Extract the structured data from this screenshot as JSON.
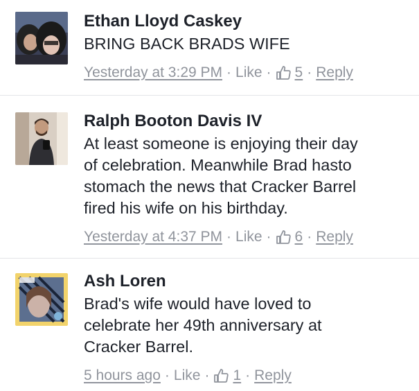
{
  "comments": [
    {
      "author": "Ethan Lloyd Caskey",
      "text": "BRING BACK BRADS WIFE",
      "timestamp": "Yesterday at 3:29 PM",
      "like_label": "Like",
      "like_count": "5",
      "reply_label": "Reply",
      "icon": "thumbs-up-icon"
    },
    {
      "author": "Ralph Booton Davis IV",
      "text": "At least someone is enjoying their day\nof celebration. Meanwhile Brad hasto\nstomach the news that Cracker Barrel\nfired his wife on his birthday.",
      "timestamp": "Yesterday at 4:37 PM",
      "like_label": "Like",
      "like_count": "6",
      "reply_label": "Reply",
      "icon": "thumbs-up-icon"
    },
    {
      "author": "Ash Loren",
      "text": "Brad's wife would have loved to\ncelebrate her 49th anniversary at\nCracker Barrel.",
      "timestamp": "5 hours ago",
      "like_label": "Like",
      "like_count": "1",
      "reply_label": "Reply",
      "icon": "thumbs-up-icon"
    }
  ],
  "separator": "·",
  "colors": {
    "text": "#1d2129",
    "meta": "#90949c",
    "divider": "#e3e4e8"
  }
}
